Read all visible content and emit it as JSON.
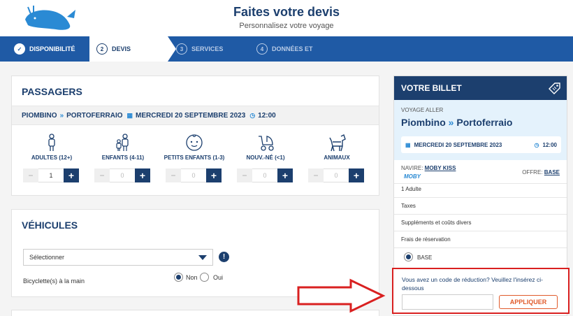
{
  "header": {
    "title": "Faites votre devis",
    "subtitle": "Personnalisez votre voyage"
  },
  "steps": [
    {
      "num": "✓",
      "label": "DISPONIBILITÉ",
      "state": "done"
    },
    {
      "num": "2",
      "label": "DEVIS",
      "state": "active"
    },
    {
      "num": "3",
      "label": "SERVICES",
      "state": "todo"
    },
    {
      "num": "4",
      "label": "DONNÉES ET",
      "state": "todo"
    }
  ],
  "passengers": {
    "title": "PASSAGERS",
    "route_from": "PIOMBINO",
    "route_sep": "»",
    "route_to": "PORTOFERRAIO",
    "date": "MERCREDI 20 SEPTEMBRE 2023",
    "time": "12:00",
    "types": [
      {
        "label": "ADULTES (12+)",
        "value": "1",
        "icon": "adult-icon"
      },
      {
        "label": "ENFANTS (4-11)",
        "value": "0",
        "icon": "child-icon"
      },
      {
        "label": "PETITS ENFANTS (1-3)",
        "value": "0",
        "icon": "baby-face-icon"
      },
      {
        "label": "NOUV.-NÉ (<1)",
        "value": "0",
        "icon": "stroller-icon"
      },
      {
        "label": "ANIMAUX",
        "value": "0",
        "icon": "dog-icon"
      }
    ],
    "minus": "−",
    "plus": "+"
  },
  "vehicles": {
    "title": "VÉHICULES",
    "select_value": "Sélectionner",
    "warning": "!",
    "bike_label": "Bicyclette(s) à la main",
    "opt_no": "Non",
    "opt_yes": "Oui",
    "selected": "Non"
  },
  "ticket": {
    "title": "VOTRE BILLET",
    "trip_type": "VOYAGE ALLER",
    "from": "Piombino",
    "sep": "»",
    "to": "Portoferraio",
    "date": "MERCREDI 20 SEPTEMBRE 2023",
    "time": "12:00",
    "ship_label": "NAVIRE:",
    "ship_name": "MOBY KISS",
    "brand": "MOBY",
    "offer_label": "OFFRE:",
    "offer_value": "BASE",
    "items": [
      "1 Adulte",
      "Taxes",
      "Suppléments et coûts divers",
      "Frais de réservation"
    ],
    "base_option": "BASE"
  },
  "promo": {
    "text": "Vous avez un code de réduction? Veuillez l'insérez ci-dessous",
    "input_value": "",
    "button": "APPLIQUER"
  },
  "colors": {
    "navy": "#1c3f6e",
    "step_bar": "#1f5aa5",
    "accent_blue": "#2a8ad4",
    "highlight_red": "#d92020",
    "button_orange": "#e05a2a"
  }
}
